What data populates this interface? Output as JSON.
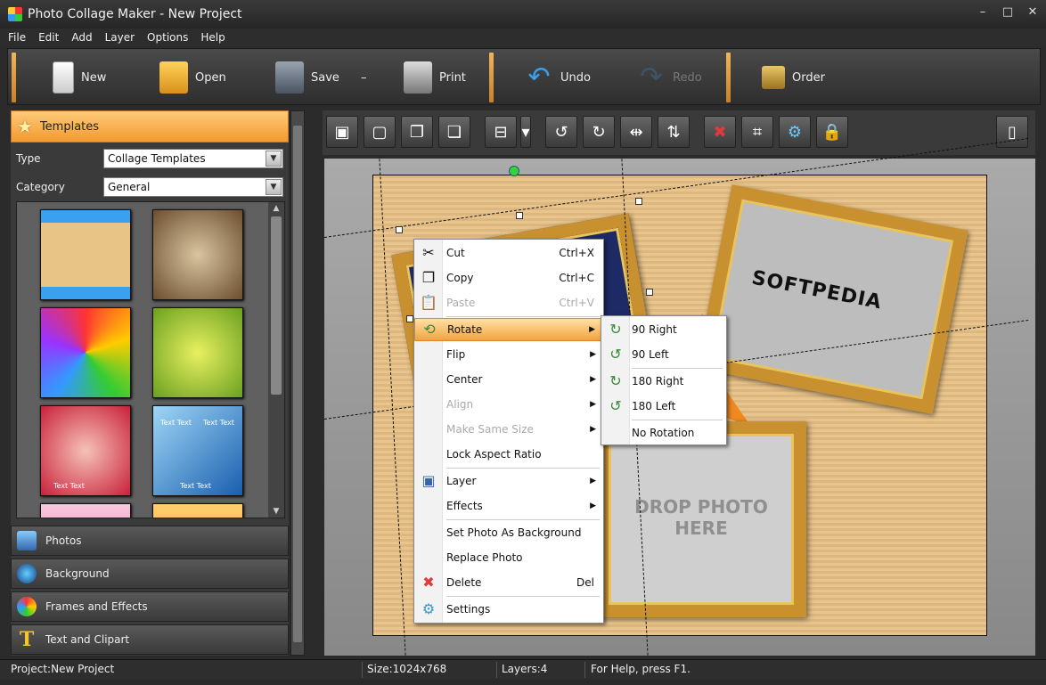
{
  "window": {
    "title": "Photo Collage Maker - New Project"
  },
  "menu": [
    "File",
    "Edit",
    "Add",
    "Layer",
    "Options",
    "Help"
  ],
  "toolbar": {
    "new": "New",
    "open": "Open",
    "save": "Save",
    "print": "Print",
    "undo": "Undo",
    "redo": "Redo",
    "order": "Order"
  },
  "templates_panel": {
    "header": "Templates",
    "type_label": "Type",
    "type_value": "Collage Templates",
    "category_label": "Category",
    "category_value": "General",
    "thumb_texts": [
      "Text Text",
      "Text Text",
      "Text Text",
      "Text Text"
    ]
  },
  "panel_tabs": [
    "Photos",
    "Background",
    "Frames and Effects",
    "Text and Clipart"
  ],
  "canvas": {
    "frame_text": "SOFTPEDIA",
    "drop_line1": "DROP PHOTO",
    "drop_line2": "HERE"
  },
  "context_menu": {
    "items": [
      {
        "label": "Cut",
        "shortcut": "Ctrl+X"
      },
      {
        "label": "Copy",
        "shortcut": "Ctrl+C"
      },
      {
        "label": "Paste",
        "shortcut": "Ctrl+V"
      },
      {
        "label": "Rotate"
      },
      {
        "label": "Flip"
      },
      {
        "label": "Center"
      },
      {
        "label": "Align"
      },
      {
        "label": "Make Same Size"
      },
      {
        "label": "Lock Aspect Ratio"
      },
      {
        "label": "Layer"
      },
      {
        "label": "Effects"
      },
      {
        "label": "Set Photo As Background"
      },
      {
        "label": "Replace Photo"
      },
      {
        "label": "Delete",
        "shortcut": "Del"
      },
      {
        "label": "Settings"
      }
    ]
  },
  "rotate_submenu": [
    "90 Right",
    "90 Left",
    "180 Right",
    "180 Left",
    "No Rotation"
  ],
  "statusbar": {
    "project": "Project:New Project",
    "size": "Size:1024x768",
    "layers": "Layers:4",
    "help": "For Help, press F1."
  }
}
